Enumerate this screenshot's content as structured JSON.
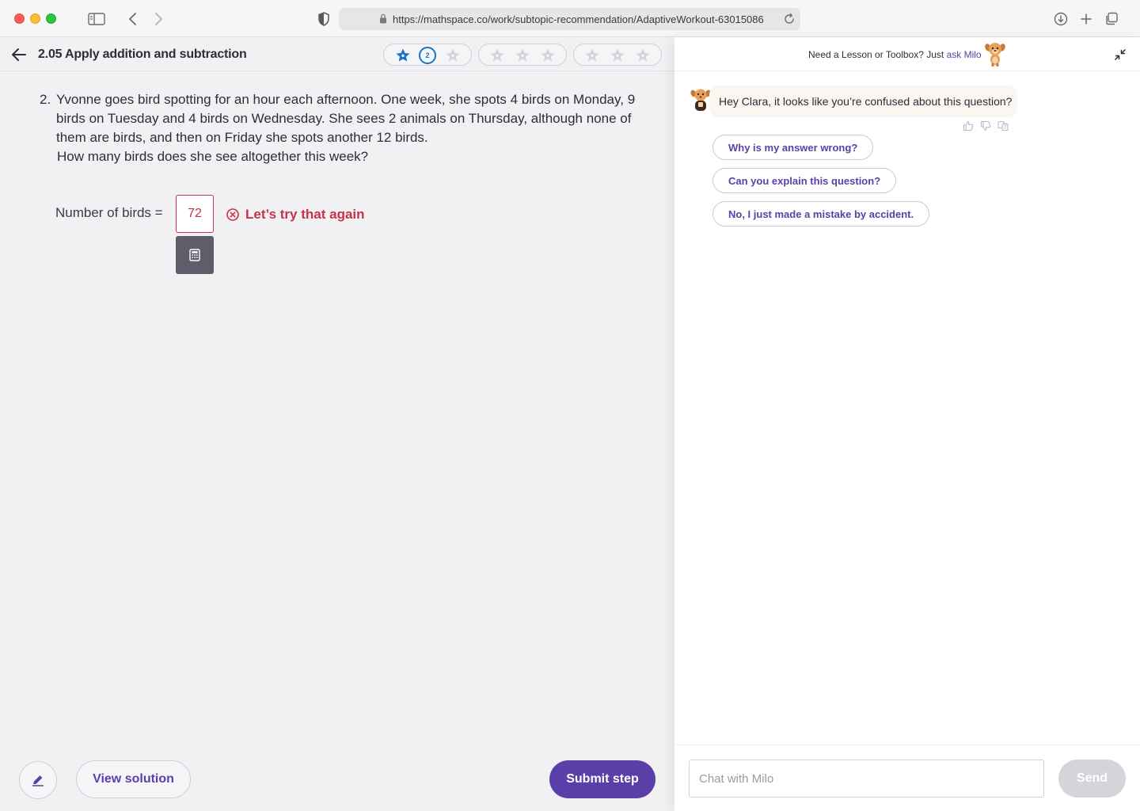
{
  "browser": {
    "url": "https://mathspace.co/work/subtopic-recommendation/AdaptiveWorkout-63015086"
  },
  "topbar": {
    "title": "2.05 Apply addition and subtraction",
    "progress_number": "2"
  },
  "question": {
    "number": "2.",
    "text": "Yvonne goes bird spotting for an hour each afternoon. One week, she spots 4 birds on Monday, 9 birds on Tuesday and 4 birds on Wednesday. She sees 2 animals on Thursday, although none of them are birds, and then on Friday she spots another 12 birds.",
    "ask": "How many birds does she see altogether this week?"
  },
  "answer": {
    "label": "Number of birds =",
    "value": "72",
    "feedback": "Let’s try that again"
  },
  "footer": {
    "view_solution": "View solution",
    "submit_step": "Submit step"
  },
  "chat": {
    "header_prefix": "Need a Lesson or Toolbox? Just ",
    "header_link": "ask Milo",
    "bot_message": "Hey Clara, it looks like you’re confused about this question?",
    "suggestions": [
      "Why is my answer wrong?",
      "Can you explain this question?",
      "No, I just made a mistake by accident."
    ],
    "input_placeholder": "Chat with Milo",
    "send_label": "Send"
  },
  "colors": {
    "brand_purple": "#5b3fa8",
    "error_red": "#c8314a",
    "progress_blue": "#1a73c8"
  }
}
